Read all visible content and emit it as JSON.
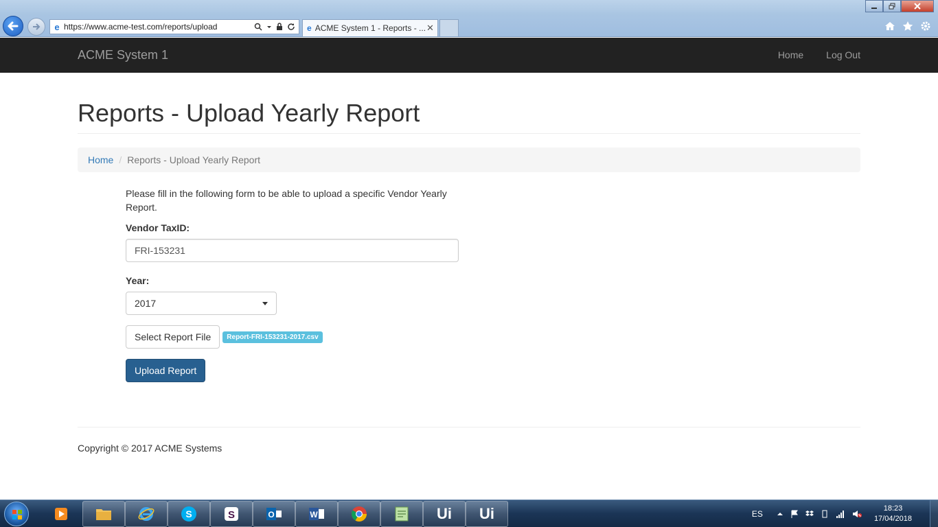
{
  "browser": {
    "address_url": "https://www.acme-test.com/reports/upload",
    "tab_title": "ACME System 1 - Reports - ...",
    "tab_close": "✕"
  },
  "navbar": {
    "brand": "ACME System 1",
    "links": [
      "Home",
      "Log Out"
    ]
  },
  "page": {
    "title": "Reports - Upload Yearly Report",
    "breadcrumb": {
      "home": "Home",
      "separator": "/",
      "current": "Reports - Upload Yearly Report"
    }
  },
  "form": {
    "intro": "Please fill in the following form to be able to upload a specific Vendor Yearly Report.",
    "vendor_label": "Vendor TaxID:",
    "vendor_value": "FRI-153231",
    "year_label": "Year:",
    "year_value": "2017",
    "file_button": "Select Report File",
    "file_name": "Report-FRI-153231-2017.csv",
    "upload_button": "Upload Report"
  },
  "footer": {
    "copyright": "Copyright © 2017 ACME Systems"
  },
  "taskbar": {
    "apps": [
      "media-player",
      "file-explorer",
      "internet-explorer",
      "skype",
      "slack",
      "outlook",
      "word",
      "chrome",
      "notepad",
      "uipath",
      "uipath"
    ],
    "uipath_label": "Ui",
    "language": "ES",
    "time": "18:23",
    "date": "17/04/2018"
  },
  "colors": {
    "navbar_bg": "#222222",
    "link": "#337ab7",
    "primary_button": "#286090",
    "file_badge": "#5bc0de"
  }
}
